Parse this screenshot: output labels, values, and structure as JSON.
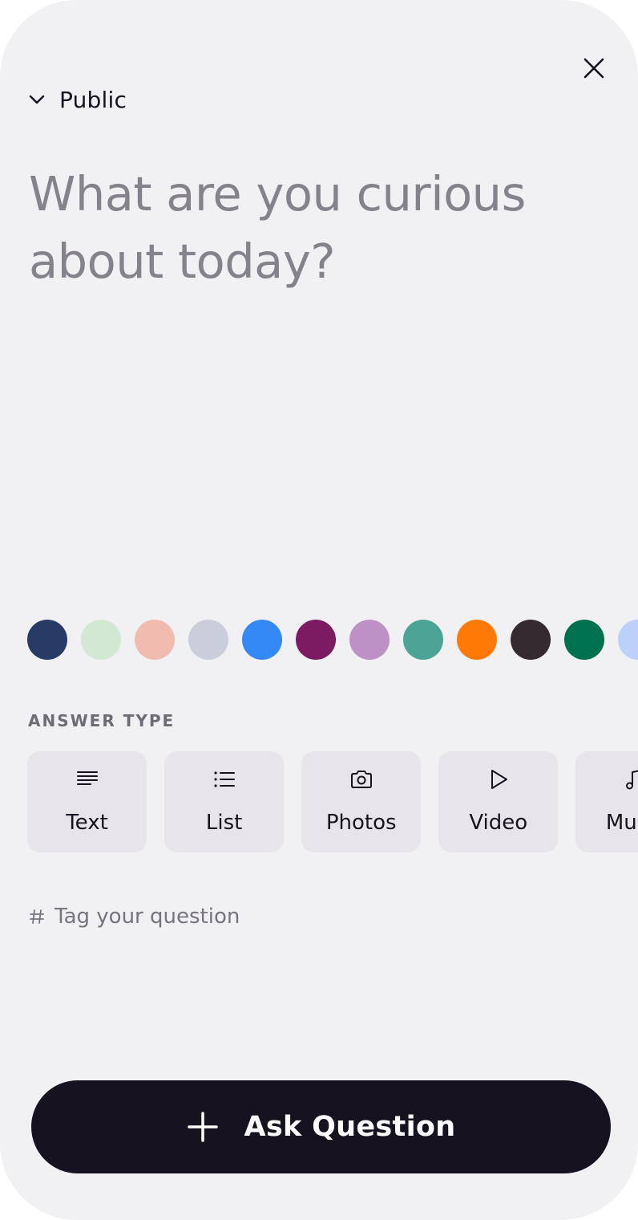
{
  "header": {
    "close_icon": "close-icon",
    "visibility": {
      "icon": "chevron-down-icon",
      "label": "Public"
    }
  },
  "question": {
    "value": "",
    "placeholder": "What are you curious about today?"
  },
  "colors": [
    "#283a66",
    "#d3e8d3",
    "#f2bbb0",
    "#cacdda",
    "#3589f6",
    "#7c1b62",
    "#be91c6",
    "#4ca594",
    "#ff7906",
    "#352a2f",
    "#00714e",
    "#bcd1fa"
  ],
  "answer_type": {
    "label": "ANSWER TYPE",
    "options": [
      {
        "label": "Text",
        "icon": "text-align-icon"
      },
      {
        "label": "List",
        "icon": "list-icon"
      },
      {
        "label": "Photos",
        "icon": "camera-icon"
      },
      {
        "label": "Video",
        "icon": "play-icon"
      },
      {
        "label": "Music",
        "icon": "music-note-icon"
      }
    ]
  },
  "tags": {
    "icon": "hash-icon",
    "value": "",
    "placeholder": "Tag your question"
  },
  "submit": {
    "icon": "plus-icon",
    "label": "Ask Question"
  }
}
